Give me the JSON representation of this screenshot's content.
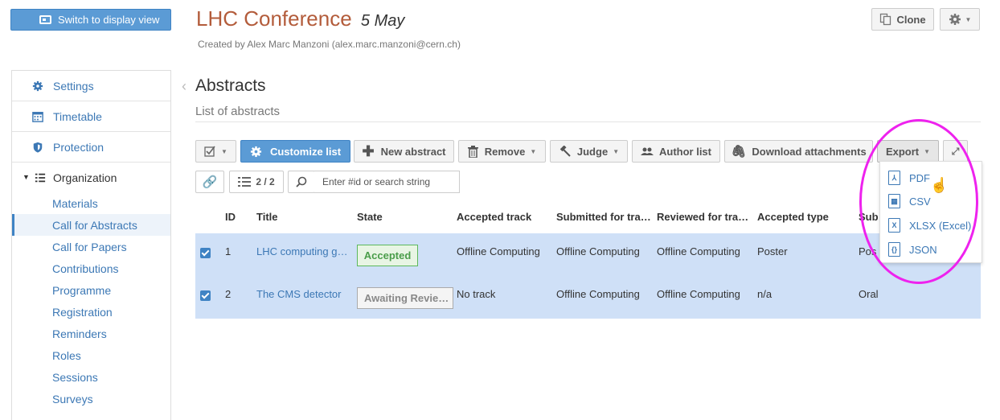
{
  "header": {
    "switch_label": "Switch to display view",
    "title": "LHC Conference",
    "date": "5 May",
    "created_by": "Created by Alex Marc Manzoni (alex.marc.manzoni@cern.ch)",
    "clone_label": "Clone",
    "settings_icon": "gear-icon"
  },
  "sidebar": {
    "top_items": [
      {
        "label": "Settings",
        "icon": "gear-icon"
      },
      {
        "label": "Timetable",
        "icon": "calendar-icon"
      },
      {
        "label": "Protection",
        "icon": "shield-icon"
      }
    ],
    "organization": {
      "label": "Organization",
      "icon": "list-icon",
      "items": [
        "Materials",
        "Call for Abstracts",
        "Call for Papers",
        "Contributions",
        "Programme",
        "Registration",
        "Reminders",
        "Roles",
        "Sessions",
        "Surveys"
      ],
      "active_index": 1
    }
  },
  "main": {
    "title": "Abstracts",
    "subtitle": "List of abstracts",
    "toolbar": {
      "customize": "Customize list",
      "new_abstract": "New abstract",
      "remove": "Remove",
      "judge": "Judge",
      "author_list": "Author list",
      "download": "Download attachments",
      "export": "Export"
    },
    "filter": {
      "count": "2 / 2",
      "search_placeholder": "Enter #id or search string"
    },
    "table": {
      "headers": [
        "ID",
        "Title",
        "State",
        "Accepted track",
        "Submitted for tra…",
        "Reviewed for tra…",
        "Accepted type",
        "Sub"
      ],
      "rows": [
        {
          "id": "1",
          "title": "LHC computing g…",
          "state": "Accepted",
          "accepted_track": "Offline Computing",
          "submitted_for": "Offline Computing",
          "reviewed_for": "Offline Computing",
          "accepted_type": "Poster",
          "sub": "Pos"
        },
        {
          "id": "2",
          "title": "The CMS detector",
          "state": "Awaiting Revie…",
          "accepted_track": "No track",
          "submitted_for": "Offline Computing",
          "reviewed_for": "Offline Computing",
          "accepted_type": "n/a",
          "sub": "Oral"
        }
      ]
    }
  },
  "export_menu": {
    "items": [
      "PDF",
      "CSV",
      "XLSX (Excel)",
      "JSON"
    ]
  },
  "colors": {
    "accent": "#5b9bd5",
    "title": "#b35c3b",
    "link": "#3c78b5",
    "selected_row": "#cfe0f7",
    "highlight": "#ee22ee"
  }
}
